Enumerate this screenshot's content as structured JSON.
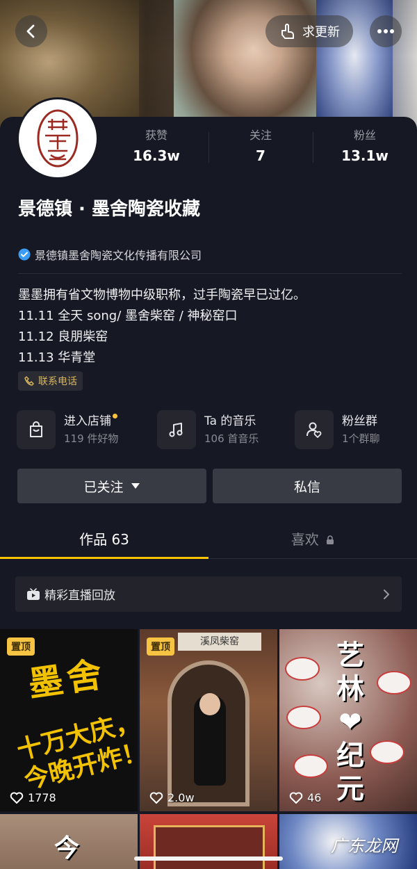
{
  "header": {
    "update_label": "求更新"
  },
  "stats": [
    {
      "label": "获赞",
      "value": "16.3w"
    },
    {
      "label": "关注",
      "value": "7"
    },
    {
      "label": "粉丝",
      "value": "13.1w"
    }
  ],
  "avatar_text": "墨舍",
  "profile": {
    "name": "景德镇 · 墨舍陶瓷收藏",
    "verified_org": "景德镇墨舍陶瓷文化传播有限公司",
    "bio_lines": [
      "墨墨拥有省文物博物中级职称，过手陶瓷早已过亿。",
      "11.11  全天 song/ 墨舍柴窑 / 神秘窑口",
      "11.12  良朋柴窑",
      "11.13    华青堂"
    ],
    "phone_tag": "联系电话"
  },
  "services": [
    {
      "title": "进入店铺",
      "sub": "119 件好物",
      "icon": "shopping-bag-icon"
    },
    {
      "title": "Ta 的音乐",
      "sub": "106 首音乐",
      "icon": "music-note-icon"
    },
    {
      "title": "粉丝群",
      "sub": "1个群聊",
      "icon": "fan-group-icon"
    }
  ],
  "actions": {
    "follow_label": "已关注",
    "message_label": "私信"
  },
  "tabs": [
    {
      "label": "作品 63"
    },
    {
      "label": "喜欢"
    }
  ],
  "live_replay": "精彩直播回放",
  "videos": [
    {
      "pinned_label": "置顶",
      "likes": "1778",
      "overlay_top": "墨舍",
      "overlay_bottom": "十万大庆，今晚开炸！"
    },
    {
      "pinned_label": "置顶",
      "likes": "2.0w",
      "sign": "溪凤柴窑"
    },
    {
      "likes": "46",
      "overlay": "艺林❤纪元"
    }
  ],
  "row2": {
    "first_text": "今"
  },
  "watermark": "广东龙网",
  "colors": {
    "background": "#161823",
    "accent": "#ffc300",
    "pinned": "#f6c342",
    "verify_blue": "#3b9cf6"
  }
}
